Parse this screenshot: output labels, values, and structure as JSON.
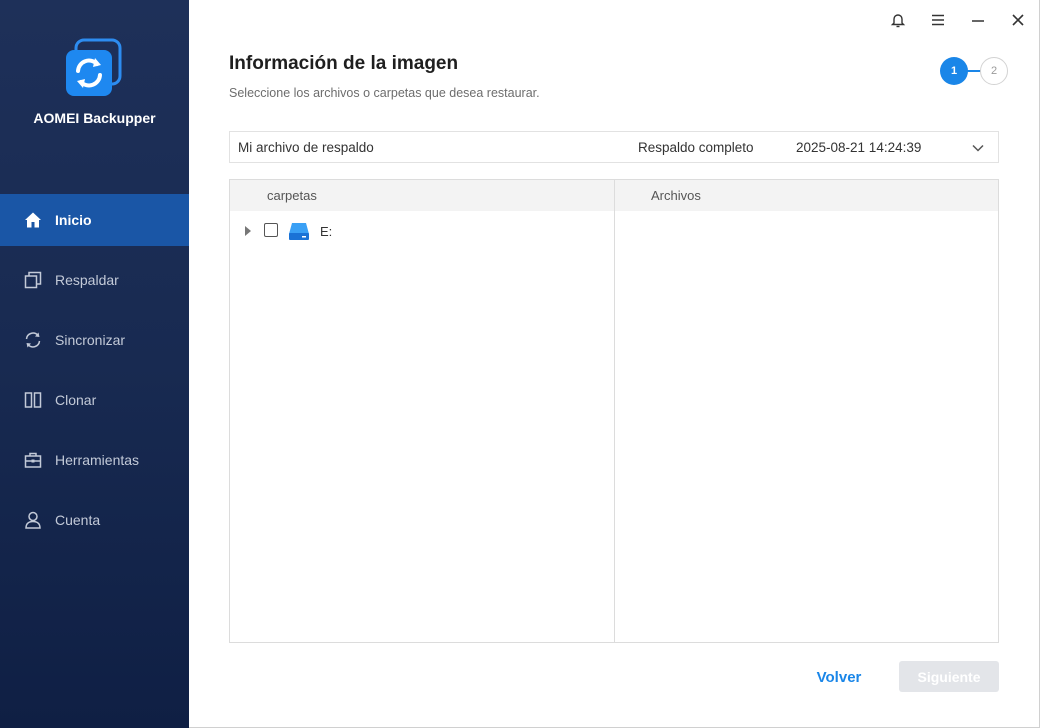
{
  "app": {
    "name": "AOMEI Backupper"
  },
  "sidebar": {
    "items": [
      {
        "label": "Inicio",
        "icon": "home-icon",
        "active": true
      },
      {
        "label": "Respaldar",
        "icon": "backup-icon",
        "active": false
      },
      {
        "label": "Sincronizar",
        "icon": "sync-icon",
        "active": false
      },
      {
        "label": "Clonar",
        "icon": "clone-icon",
        "active": false
      },
      {
        "label": "Herramientas",
        "icon": "toolbox-icon",
        "active": false
      },
      {
        "label": "Cuenta",
        "icon": "user-icon",
        "active": false
      }
    ]
  },
  "window_controls": [
    "bell-icon",
    "menu-icon",
    "minimize-icon",
    "close-icon"
  ],
  "header": {
    "title": "Información de la imagen",
    "subtitle": "Seleccione los archivos o carpetas que desea restaurar."
  },
  "steps": {
    "current": "1",
    "next": "2"
  },
  "backup_selector": {
    "name": "Mi archivo de respaldo",
    "type": "Respaldo completo",
    "date": "2025-08-21 14:24:39"
  },
  "panels": {
    "left_header": "carpetas",
    "right_header": "Archivos",
    "tree": [
      {
        "label": "E:",
        "icon": "drive-icon",
        "checked": false,
        "expanded": false
      }
    ]
  },
  "footer": {
    "back_label": "Volver",
    "next_label": "Siguiente"
  },
  "colors": {
    "sidebar_bg": "#182a51",
    "sidebar_active": "#1a56a6",
    "accent": "#1a86e8",
    "disabled_button": "#e3e5e9"
  }
}
